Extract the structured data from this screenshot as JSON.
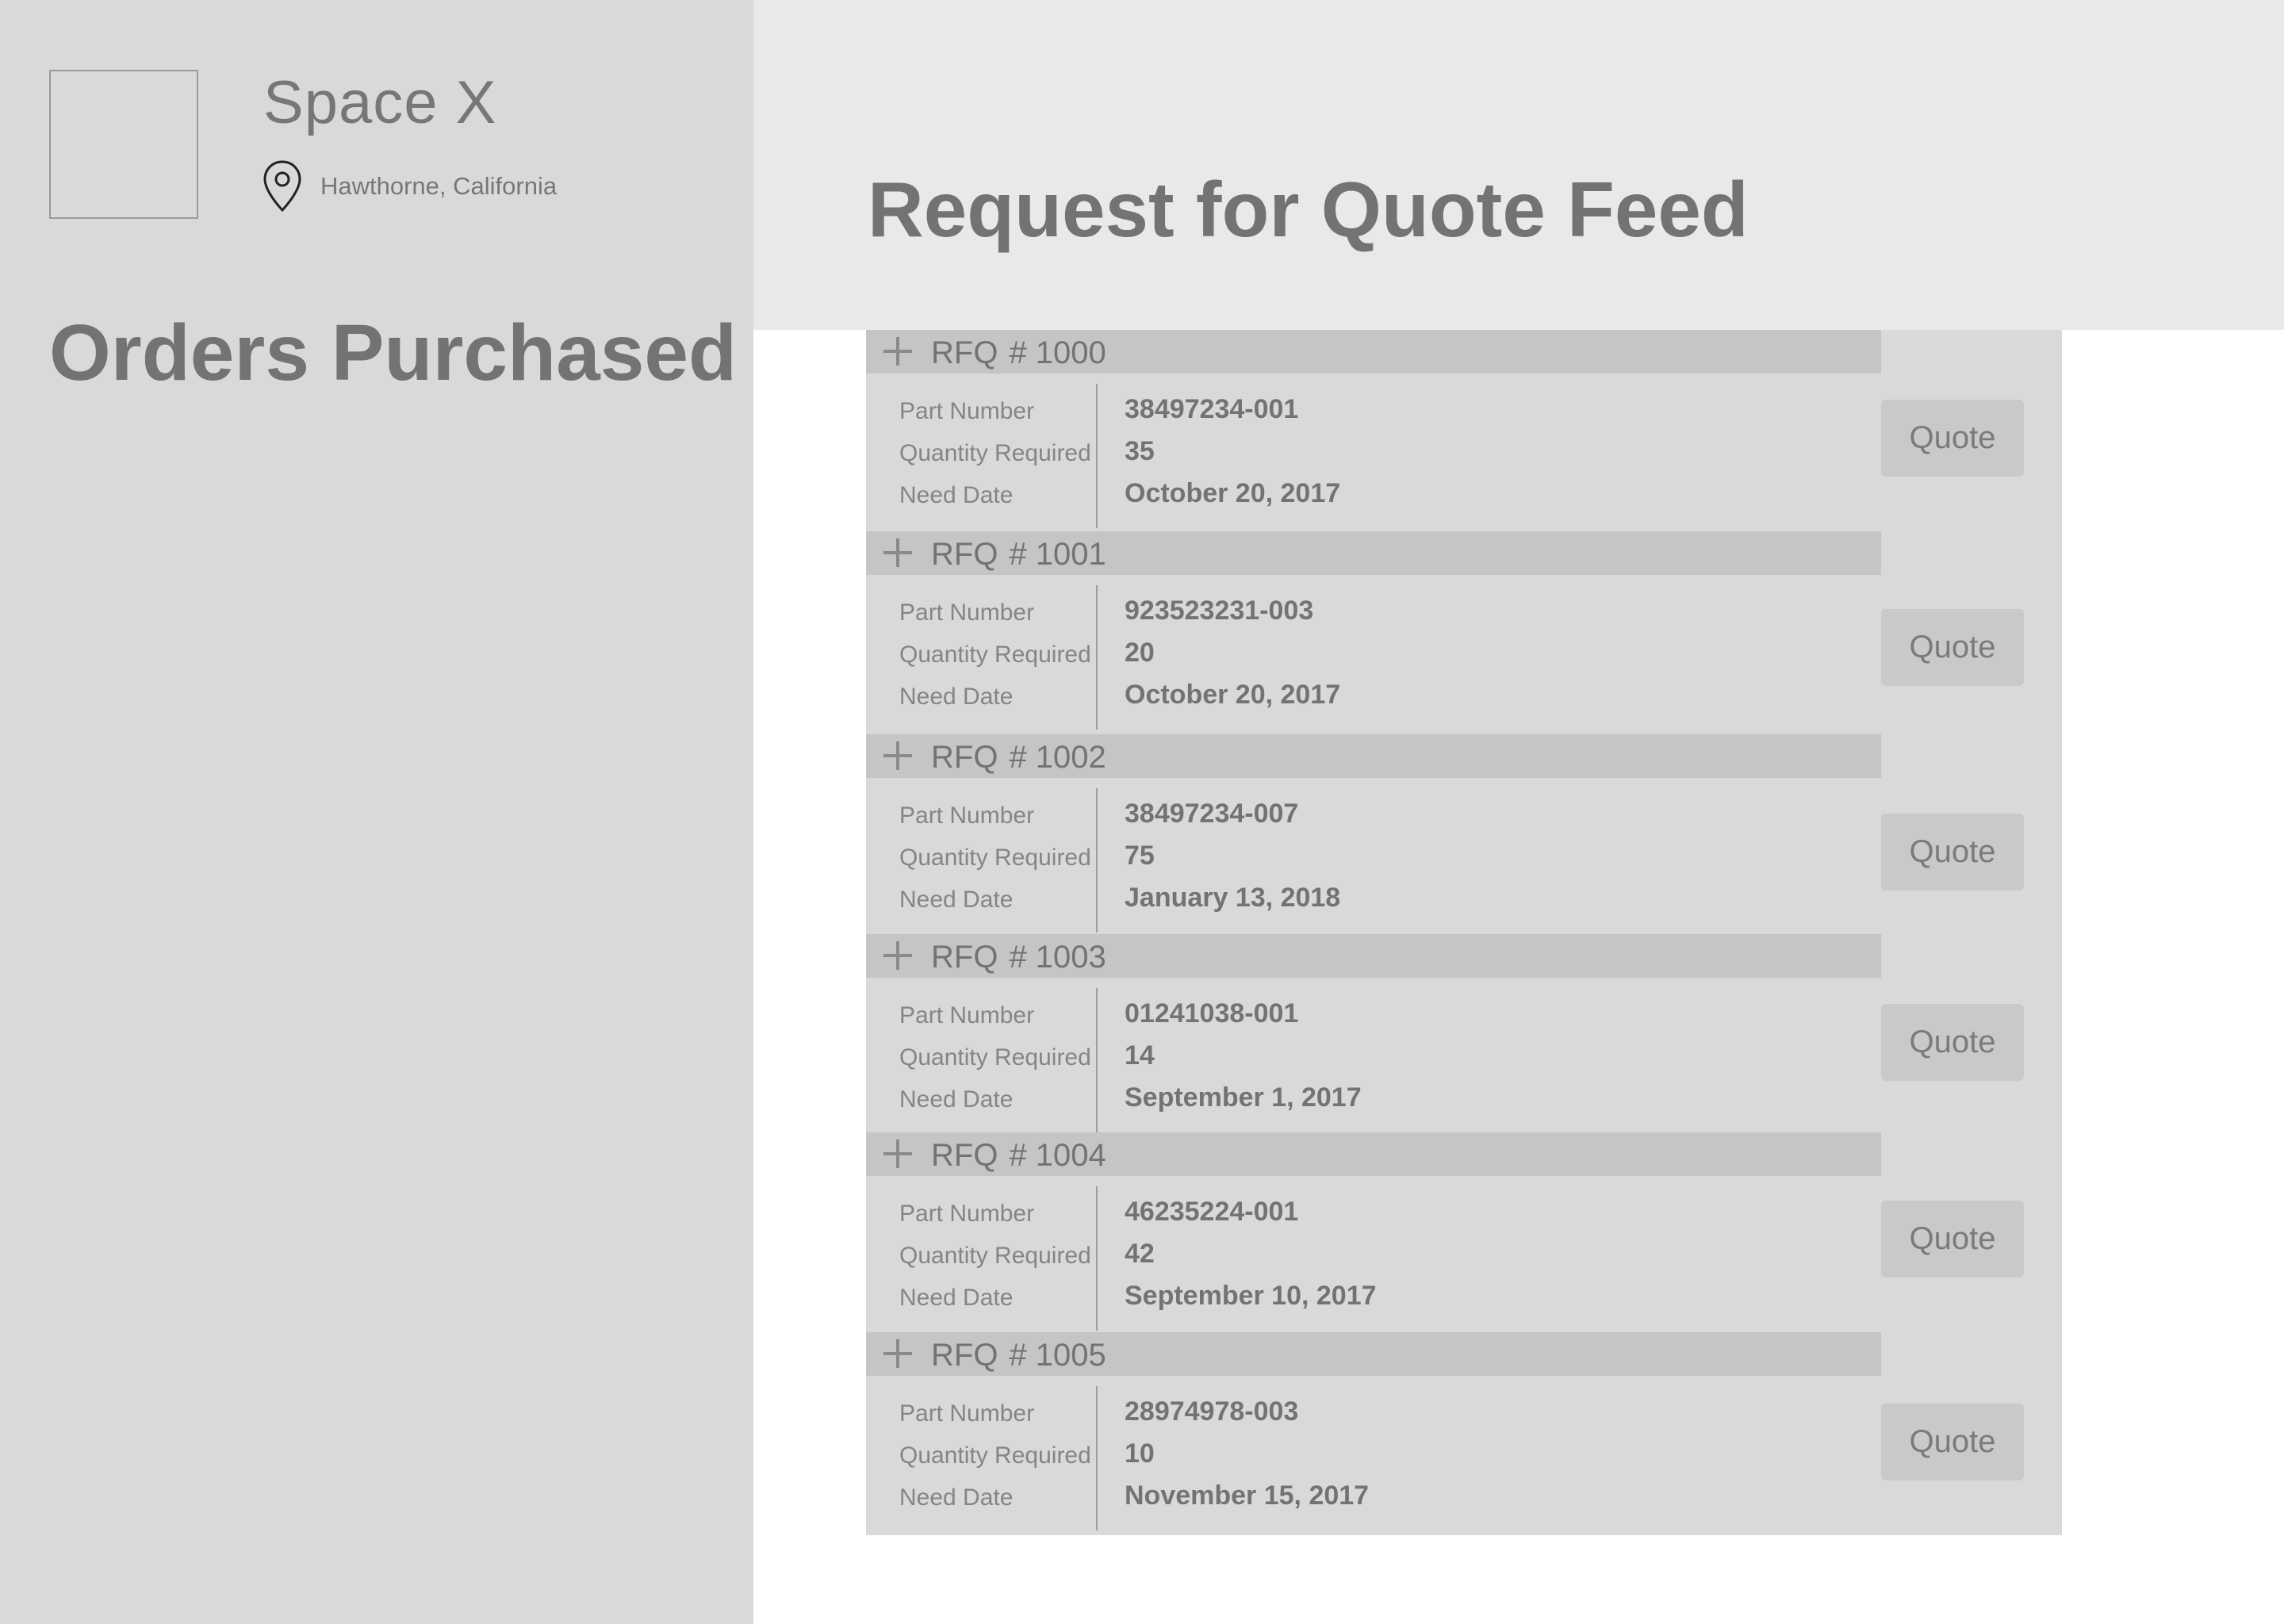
{
  "company": {
    "name": "Space X",
    "location": "Hawthorne, California"
  },
  "sidebar": {
    "heading": "Orders Purchased"
  },
  "feed": {
    "title": "Request for Quote Feed",
    "field_labels": {
      "part_number": "Part Number",
      "quantity_required": "Quantity Required",
      "need_date": "Need Date"
    },
    "quote_label": "Quote",
    "rfq_prefix": "RFQ",
    "items": [
      {
        "number": "# 1000",
        "part_number": "38497234-001",
        "quantity": "35",
        "need_date": "October 20, 2017"
      },
      {
        "number": "# 1001",
        "part_number": "923523231-003",
        "quantity": "20",
        "need_date": "October 20, 2017"
      },
      {
        "number": "# 1002",
        "part_number": "38497234-007",
        "quantity": "75",
        "need_date": "January 13, 2018"
      },
      {
        "number": "# 1003",
        "part_number": "01241038-001",
        "quantity": "14",
        "need_date": "September 1, 2017"
      },
      {
        "number": "# 1004",
        "part_number": "46235224-001",
        "quantity": "42",
        "need_date": "September 10, 2017"
      },
      {
        "number": "# 1005",
        "part_number": "28974978-003",
        "quantity": "10",
        "need_date": "November 15, 2017"
      }
    ]
  },
  "colors": {
    "sidebar_bg": "#d9d9d9",
    "header_bg": "#e9e9e9",
    "rfq_header_bg": "#c6c4c5",
    "text": "#737373"
  }
}
